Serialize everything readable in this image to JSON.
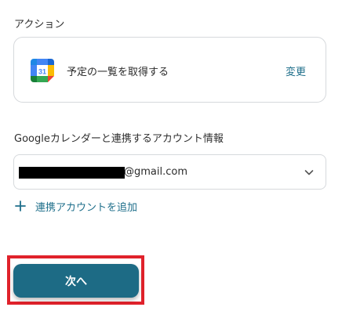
{
  "action": {
    "section_label": "アクション",
    "icon": "google-calendar-icon",
    "icon_day": "31",
    "text": "予定の一覧を取得する",
    "change_label": "変更"
  },
  "account": {
    "section_label": "Googleカレンダーと連携するアカウント情報",
    "selected_value": "@gmail.com",
    "add_label": "連携アカウントを追加"
  },
  "footer": {
    "next_label": "次へ"
  },
  "colors": {
    "accent": "#1d6b85",
    "link": "#1f6f8b",
    "highlight": "#e0222b",
    "border": "#d6d9dc"
  }
}
